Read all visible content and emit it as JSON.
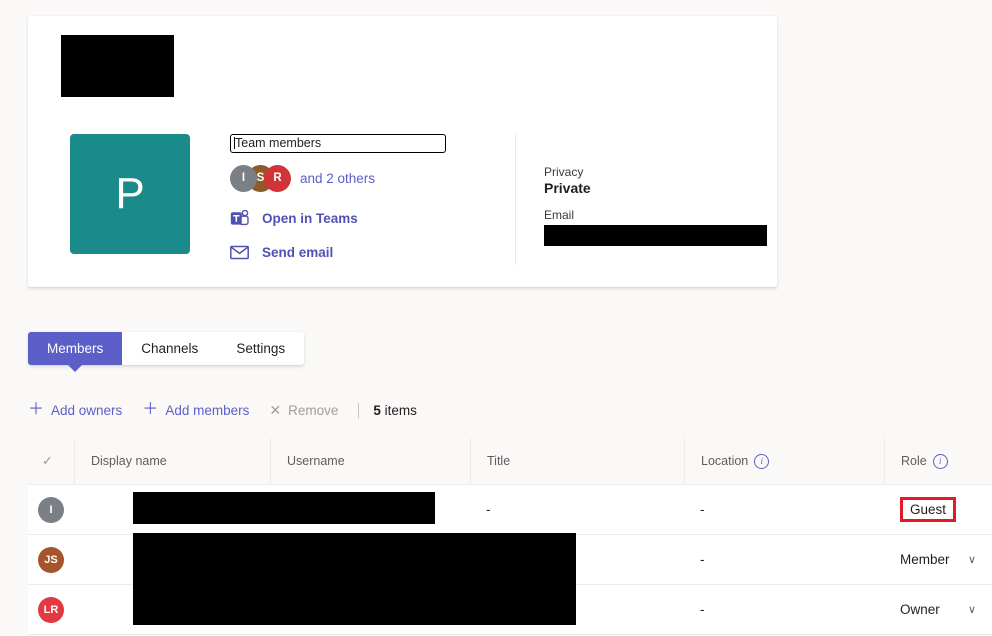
{
  "profile": {
    "team_initial": "P",
    "team_name_field": "Team members",
    "avatars": [
      {
        "initials": "I",
        "color": "#7a8085"
      },
      {
        "initials": "S",
        "color": "#8c5a2b"
      },
      {
        "initials": "R",
        "color": "#d13438"
      }
    ],
    "others_text": "and 2 others",
    "links": [
      {
        "label": "Open in Teams",
        "icon": "teams-icon"
      },
      {
        "label": "Send email",
        "icon": "envelope-icon"
      }
    ],
    "details": {
      "privacy_label": "Privacy",
      "privacy_value": "Private",
      "email_label": "Email",
      "email_value": ""
    }
  },
  "tabs": [
    {
      "label": "Members",
      "active": true
    },
    {
      "label": "Channels",
      "active": false
    },
    {
      "label": "Settings",
      "active": false
    }
  ],
  "command_bar": {
    "add_owners": "Add owners",
    "add_members": "Add members",
    "remove": "Remove",
    "count_number": "5",
    "count_label": "items"
  },
  "table": {
    "columns": [
      {
        "label": "Display name",
        "info": false
      },
      {
        "label": "Username",
        "info": false
      },
      {
        "label": "Title",
        "info": false
      },
      {
        "label": "Location",
        "info": true
      },
      {
        "label": "Role",
        "info": true
      }
    ],
    "rows": [
      {
        "avatar_initials": "I",
        "avatar_color": "#7a8085",
        "display_name": "",
        "username": "",
        "title": "-",
        "location": "-",
        "role": "Guest",
        "role_highlighted": true,
        "role_has_chevron": false
      },
      {
        "avatar_initials": "JS",
        "avatar_color": "#a4562a",
        "display_name": "",
        "username": "",
        "title": "",
        "location": "-",
        "role": "Member",
        "role_highlighted": false,
        "role_has_chevron": true
      },
      {
        "avatar_initials": "LR",
        "avatar_color": "#e2383f",
        "display_name": "",
        "username": "",
        "title": "",
        "location": "-",
        "role": "Owner",
        "role_highlighted": false,
        "role_has_chevron": true
      }
    ]
  },
  "icons": {
    "check": "✓",
    "plus": "＋",
    "close": "✕",
    "chevron_down": "∨",
    "info": "i"
  },
  "colors": {
    "accent_purple": "#5b5fc7",
    "link_purple": "#4f52b2",
    "team_teal": "#1b8a8a",
    "highlight_red": "#e01b24",
    "page_bg": "#faf9f8"
  }
}
